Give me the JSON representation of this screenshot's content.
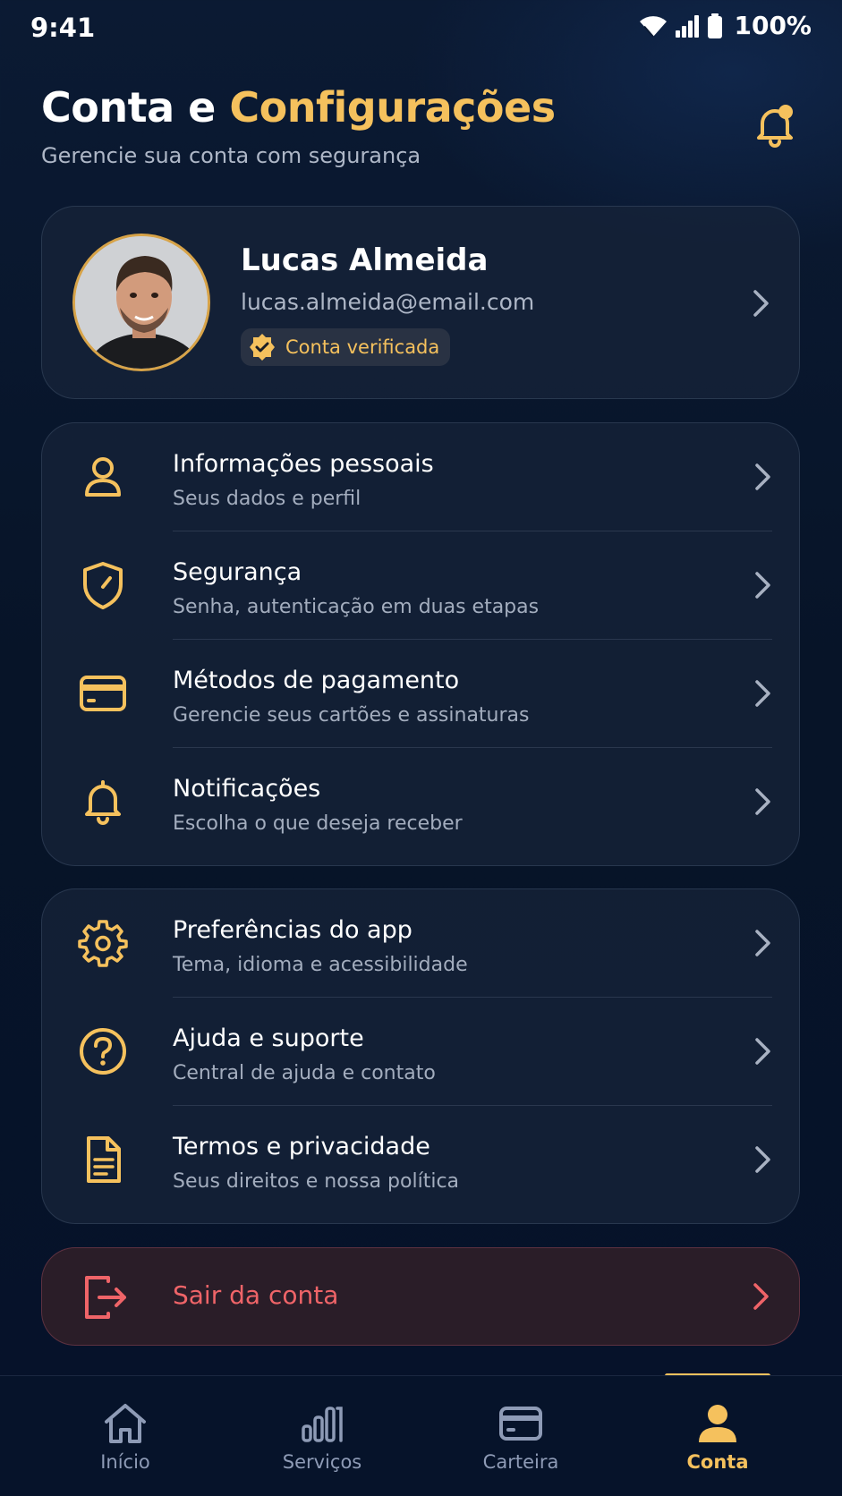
{
  "status_bar": {
    "time": "9:41",
    "battery": "100%"
  },
  "header": {
    "title_part1": "Conta e",
    "title_accent": "Configurações",
    "subtitle": "Gerencie sua conta com segurança"
  },
  "profile": {
    "name": "Lucas Almeida",
    "email": "lucas.almeida@email.com",
    "badge": "Conta verificada"
  },
  "menu_group_1": [
    {
      "icon": "user-icon",
      "title": "Informações pessoais",
      "subtitle": "Seus dados e perfil"
    },
    {
      "icon": "shield-icon",
      "title": "Segurança",
      "subtitle": "Senha, autenticação em duas etapas"
    },
    {
      "icon": "credit-card-icon",
      "title": "Métodos de pagamento",
      "subtitle": "Gerencie seus cartões e assinaturas"
    },
    {
      "icon": "bell-icon",
      "title": "Notificações",
      "subtitle": "Escolha o que deseja receber"
    }
  ],
  "menu_group_2": [
    {
      "icon": "gear-icon",
      "title": "Preferências do app",
      "subtitle": "Tema, idioma e acessibilidade"
    },
    {
      "icon": "help-circle-icon",
      "title": "Ajuda e suporte",
      "subtitle": "Central de ajuda e contato"
    },
    {
      "icon": "document-icon",
      "title": "Termos e privacidade",
      "subtitle": "Seus direitos e nossa política"
    }
  ],
  "logout": {
    "label": "Sair da conta"
  },
  "bottom_nav": [
    {
      "icon": "home-icon",
      "label": "Início"
    },
    {
      "icon": "services-icon",
      "label": "Serviços"
    },
    {
      "icon": "wallet-icon",
      "label": "Carteira"
    },
    {
      "icon": "account-icon",
      "label": "Conta",
      "active": true
    }
  ],
  "colors": {
    "accent": "#f5c15d",
    "danger": "#ef6468",
    "background": "#071428",
    "card": "#162238"
  }
}
